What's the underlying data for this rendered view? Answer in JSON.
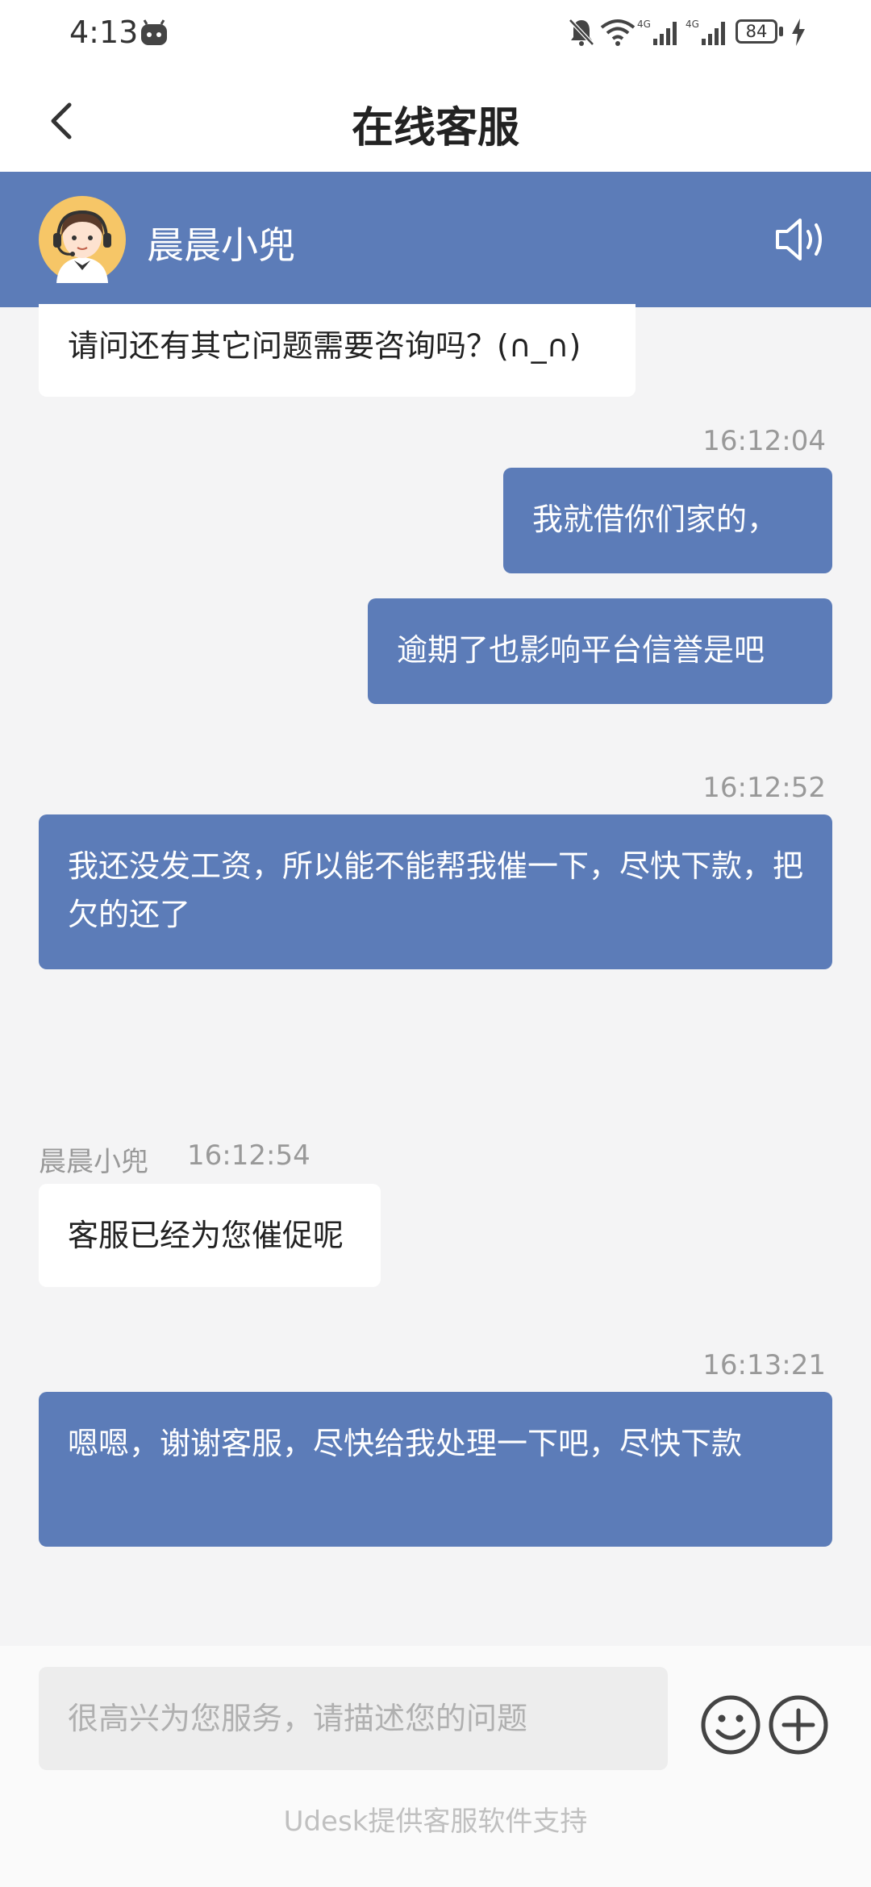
{
  "status_bar": {
    "time": "4:13",
    "battery": "84",
    "icons": [
      "robot-icon",
      "bell-off-icon",
      "wifi-icon",
      "signal-4g-icon",
      "signal-4g-icon",
      "battery-icon",
      "charging-icon"
    ]
  },
  "header": {
    "title": "在线客服",
    "back_icon": "chevron-left-icon"
  },
  "agent": {
    "name": "晨晨小兜",
    "avatar_icon": "agent-avatar",
    "speaker_icon": "speaker-icon"
  },
  "messages": [
    {
      "side": "in",
      "text": "请问还有其它问题需要咨询吗？(∩_∩)"
    },
    {
      "side": "out",
      "time": "16:12:04",
      "text": "我就借你们家的，"
    },
    {
      "side": "out",
      "text": "逾期了也影响平台信誉是吧"
    },
    {
      "side": "out",
      "time": "16:12:52",
      "text": "我还没发工资，所以能不能帮我催一下，尽快下款，把欠的还了"
    },
    {
      "side": "in",
      "sender": "晨晨小兜",
      "time": "16:12:54",
      "text": "客服已经为您催促呢"
    },
    {
      "side": "out",
      "time": "16:13:21",
      "text": "嗯嗯，谢谢客服，尽快给我处理一下吧，尽快下款"
    }
  ],
  "composer": {
    "placeholder": "很高兴为您服务，请描述您的问题",
    "emoji_icon": "emoji-icon",
    "plus_icon": "plus-icon"
  },
  "footer": {
    "text": "Udesk提供客服软件支持"
  },
  "colors": {
    "accent": "#5c7cb8",
    "background": "#f4f4f5"
  }
}
